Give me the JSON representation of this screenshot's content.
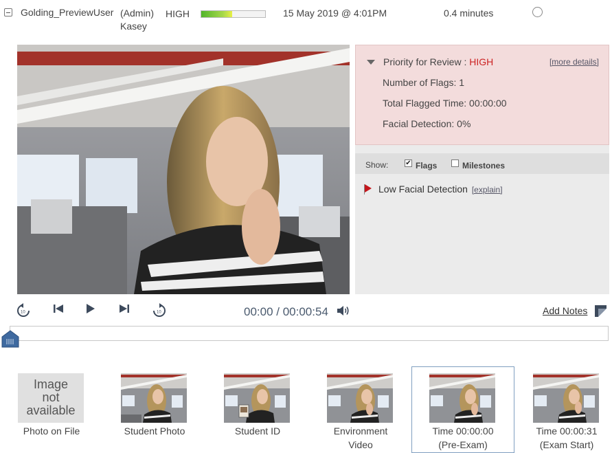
{
  "header": {
    "username": "Golding_PreviewUser",
    "role": "(Admin)",
    "name": "Kasey",
    "priority": "HIGH",
    "priority_level": 0.48,
    "datetime": "15 May 2019 @ 4:01PM",
    "duration": "0.4 minutes"
  },
  "review": {
    "title": "Priority for Review : ",
    "priority": "HIGH",
    "more_details": "[more details]",
    "flags_count": "Number of Flags: 1",
    "flagged_time": "Total Flagged Time: 00:00:00",
    "facial_detection": "Facial Detection: 0%"
  },
  "show_bar": {
    "label": "Show:",
    "flags_label": "Flags",
    "flags_checked": true,
    "milestones_label": "Milestones",
    "milestones_checked": false
  },
  "flags": [
    {
      "label": "Low Facial Detection",
      "explain": "[explain]"
    }
  ],
  "player": {
    "current_time": "00:00",
    "separator": " / ",
    "total_time": "00:00:54",
    "add_notes": "Add Notes",
    "progress": 0
  },
  "thumbnails": [
    {
      "label": "Photo on File",
      "na_line1": "Image",
      "na_line2": "not",
      "na_line3": "available"
    },
    {
      "label": "Student Photo"
    },
    {
      "label": "Student ID"
    },
    {
      "label_line1": "Environment",
      "label_line2": "Video"
    },
    {
      "label_line1": "Time 00:00:00",
      "label_line2": "(Pre-Exam)"
    },
    {
      "label_line1": "Time 00:00:31",
      "label_line2": "(Exam Start)"
    }
  ],
  "colors": {
    "priority_red": "#cc2222",
    "priority_box": "#f3dcdc",
    "flag_red": "#c4161c",
    "time_text": "#4a5a6e",
    "scrub_handle": "#3f6aa0"
  }
}
